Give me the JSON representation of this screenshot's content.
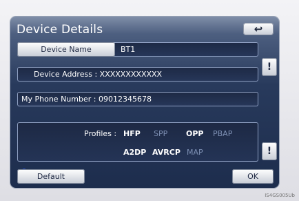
{
  "header": {
    "title": "Device Details",
    "back_icon": "↩"
  },
  "device_name": {
    "button_label": "Device Name",
    "value": "BT1"
  },
  "device_address": {
    "label": "Device Address",
    "separator": ":",
    "value": "XXXXXXXXXXXX"
  },
  "my_phone_number": {
    "label": "My Phone Number",
    "separator": ":",
    "value": "09012345678"
  },
  "profiles": {
    "label": "Profiles :",
    "items": [
      {
        "name": "HFP",
        "enabled": true
      },
      {
        "name": "SPP",
        "enabled": false
      },
      {
        "name": "OPP",
        "enabled": true
      },
      {
        "name": "PBAP",
        "enabled": false
      },
      {
        "name": "A2DP",
        "enabled": true
      },
      {
        "name": "AVRCP",
        "enabled": true
      },
      {
        "name": "MAP",
        "enabled": false
      }
    ]
  },
  "scroll": {
    "up_icon": "!",
    "down_icon": "!"
  },
  "footer": {
    "default_label": "Default",
    "ok_label": "OK"
  },
  "image_code": "IS4GS005Ub"
}
